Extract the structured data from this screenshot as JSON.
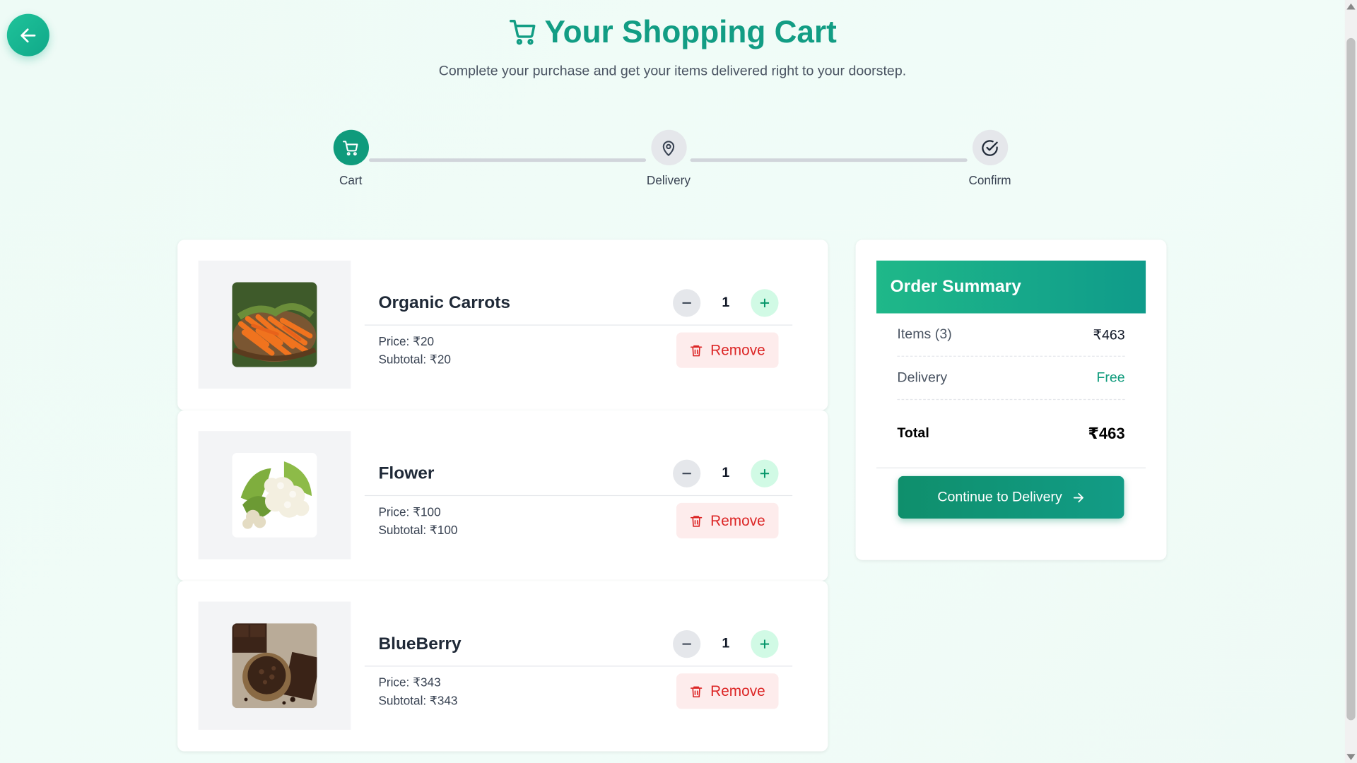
{
  "header": {
    "title": "Your Shopping Cart",
    "subtitle": "Complete your purchase and get your items delivered right to your doorstep."
  },
  "stepper": {
    "steps": [
      {
        "label": "Cart",
        "icon": "cart-icon",
        "active": true
      },
      {
        "label": "Delivery",
        "icon": "map-pin-icon",
        "active": false
      },
      {
        "label": "Confirm",
        "icon": "check-circle-icon",
        "active": false
      }
    ]
  },
  "cart": {
    "remove_label": "Remove",
    "items": [
      {
        "name": "Organic Carrots",
        "quantity": "1",
        "price": "Price: ₹20",
        "subtotal": "Subtotal: ₹20",
        "image": "carrots-image"
      },
      {
        "name": "Flower",
        "quantity": "1",
        "price": "Price: ₹100",
        "subtotal": "Subtotal: ₹100",
        "image": "cauliflower-image"
      },
      {
        "name": "BlueBerry",
        "quantity": "1",
        "price": "Price: ₹343",
        "subtotal": "Subtotal: ₹343",
        "image": "chocolate-image"
      }
    ]
  },
  "summary": {
    "title": "Order Summary",
    "items_label": "Items (3)",
    "items_value": "₹463",
    "delivery_label": "Delivery",
    "delivery_value": "Free",
    "total_label": "Total",
    "total_value": "₹463",
    "continue_label": "Continue to Delivery"
  },
  "colors": {
    "accent": "#129d84",
    "remove": "#dc2626",
    "background": "#eefbf6"
  }
}
